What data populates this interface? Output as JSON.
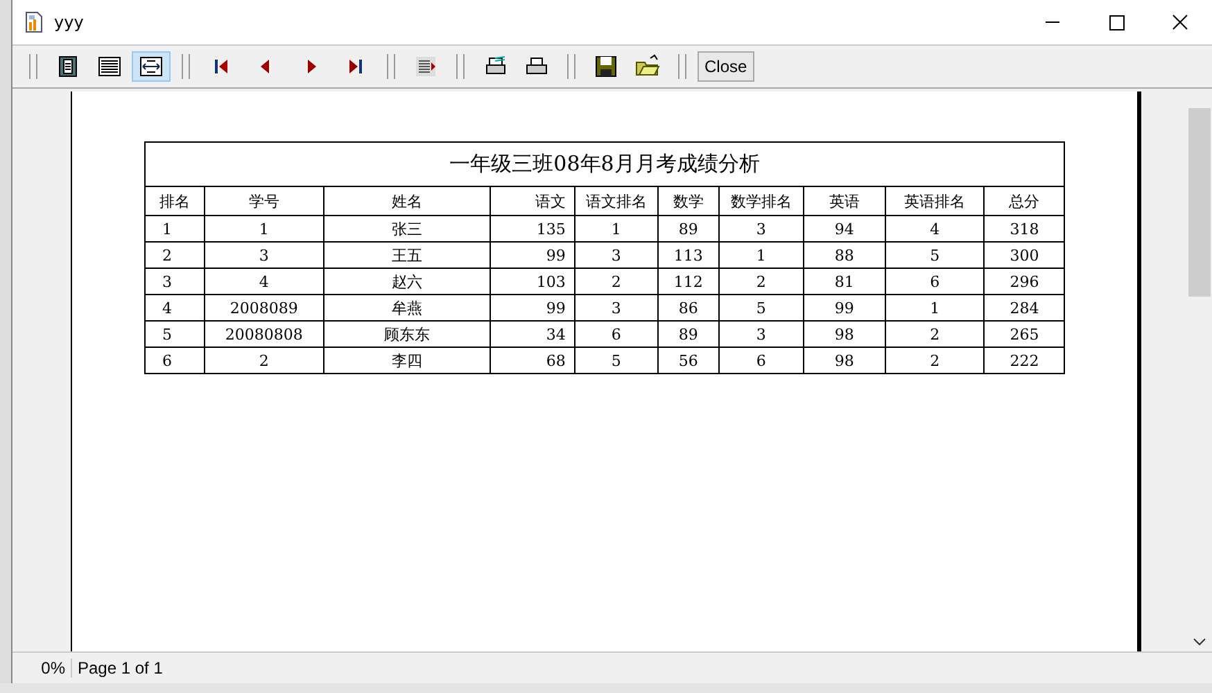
{
  "window": {
    "title": "yyy"
  },
  "toolbar": {
    "view_buttons": [
      {
        "selected": false
      },
      {
        "selected": false
      },
      {
        "selected": true
      }
    ],
    "close_button": "Close"
  },
  "report": {
    "title": "一年级三班08年8月月考成绩分析",
    "columns": [
      "排名",
      "学号",
      "姓名",
      "语文",
      "语文排名",
      "数学",
      "数学排名",
      "英语",
      "英语排名",
      "总分"
    ],
    "rows": [
      [
        "1",
        "1",
        "张三",
        "135",
        "1",
        "89",
        "3",
        "94",
        "4",
        "318"
      ],
      [
        "2",
        "3",
        "王五",
        "99",
        "3",
        "113",
        "1",
        "88",
        "5",
        "300"
      ],
      [
        "3",
        "4",
        "赵六",
        "103",
        "2",
        "112",
        "2",
        "81",
        "6",
        "296"
      ],
      [
        "4",
        "2008089",
        "牟燕",
        "99",
        "3",
        "86",
        "5",
        "99",
        "1",
        "284"
      ],
      [
        "5",
        "20080808",
        "顾东东",
        "34",
        "6",
        "89",
        "3",
        "98",
        "2",
        "265"
      ],
      [
        "6",
        "2",
        "李四",
        "68",
        "5",
        "56",
        "6",
        "98",
        "2",
        "222"
      ]
    ]
  },
  "status_bar": {
    "progress": "0%",
    "page": "Page 1 of 1"
  }
}
